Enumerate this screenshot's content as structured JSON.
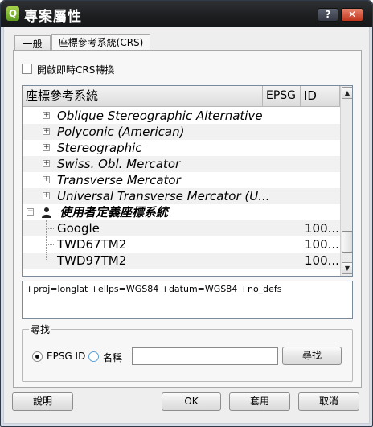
{
  "window": {
    "title": "專案屬性",
    "help_button": "?",
    "close_button": "✕",
    "app_icon_letter": "Q"
  },
  "tabs": [
    {
      "label": "一般",
      "active": false
    },
    {
      "label": "座標參考系統(CRS)",
      "active": true
    }
  ],
  "otf_checkbox": {
    "label": "開啟即時CRS轉換",
    "checked": false
  },
  "crs_tree": {
    "columns": [
      "座標參考系統",
      "EPSG",
      "ID"
    ],
    "projections": [
      "Oblique Stereographic Alternative",
      "Polyconic (American)",
      "Stereographic",
      "Swiss. Obl. Mercator",
      "Transverse Mercator",
      "Universal Transverse Mercator (U..."
    ],
    "user_group": {
      "label": "使用者定義座標系統",
      "icon": "user-icon",
      "expanded": true
    },
    "user_items": [
      {
        "name": "Google",
        "id": "100..."
      },
      {
        "name": "TWD67TM2",
        "id": "100..."
      },
      {
        "name": "TWD97TM2",
        "id": "100..."
      }
    ]
  },
  "proj_string": "+proj=longlat +ellps=WGS84 +datum=WGS84 +no_defs",
  "search": {
    "group_title": "尋找",
    "radio_epsg_label": "EPSG ID",
    "radio_name_label": "名稱",
    "selected": "EPSG ID",
    "input_value": "",
    "find_button": "尋找"
  },
  "footer": {
    "help": "說明",
    "ok": "OK",
    "apply": "套用",
    "cancel": "取消"
  },
  "colors": {
    "titlebar": "#1d1e20",
    "close_button": "#c0341c",
    "dialog_bg": "#eeeeee"
  }
}
